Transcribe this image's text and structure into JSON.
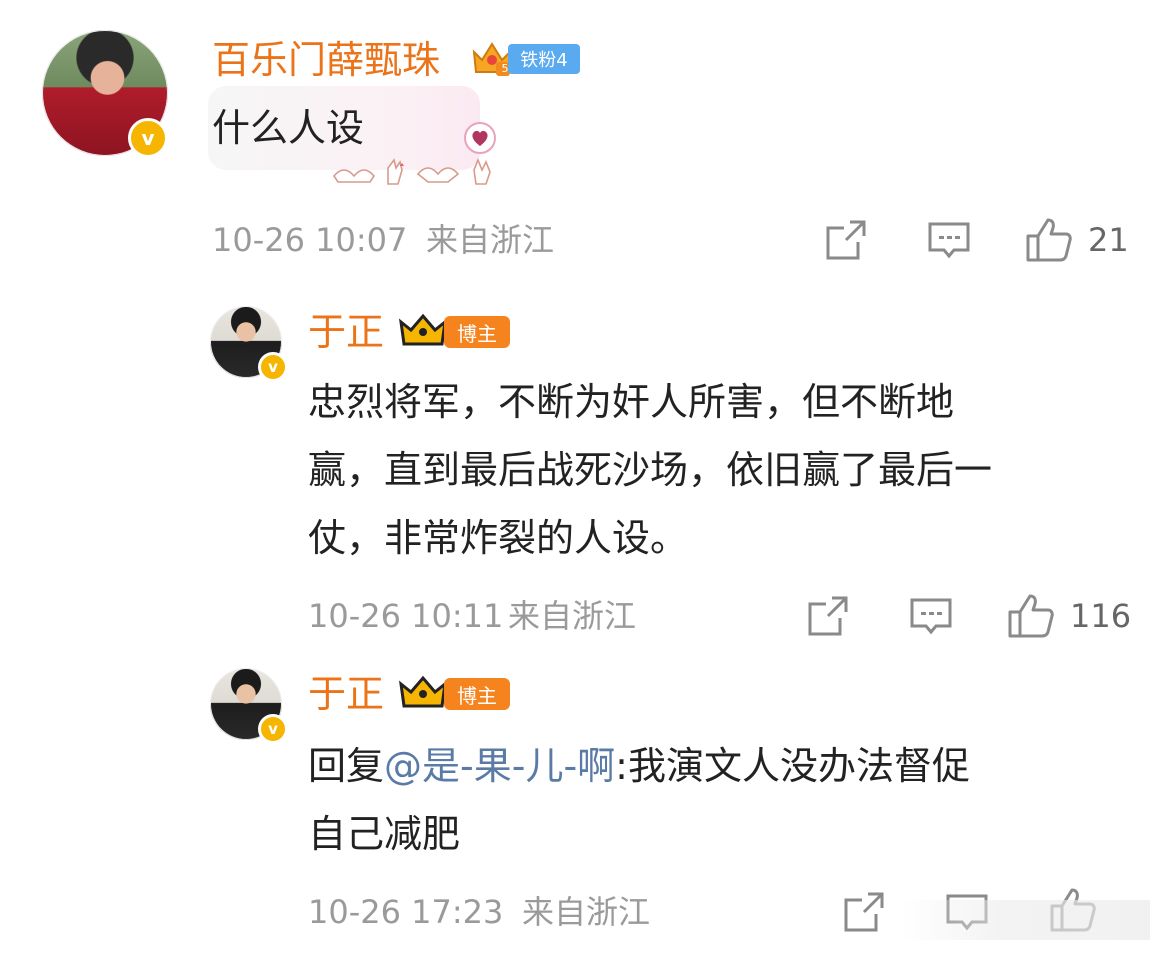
{
  "comments": [
    {
      "username": "百乐门薛甄珠",
      "fan_badge": "铁粉4",
      "fan_level": "5",
      "text": "什么人设",
      "time": "10-26 10:07",
      "location": "来自浙江",
      "likes": "21"
    },
    {
      "username": "于正",
      "role_badge": "博主",
      "text_lines": [
        "忠烈将军，不断为奸人所害，但不断地",
        "赢，直到最后战死沙场，依旧赢了最后一",
        "仗，非常炸裂的人设。"
      ],
      "time": "10-26 10:11",
      "location": "来自浙江",
      "likes": "116"
    },
    {
      "username": "于正",
      "role_badge": "博主",
      "reply_prefix": "回复",
      "mention": "@是-果-儿-啊",
      "reply_line1": ":我演文人没办法督促",
      "reply_line2": "自己减肥",
      "time": "10-26 17:23",
      "location": "来自浙江"
    }
  ],
  "icons": {
    "repost": "share-icon",
    "comment": "comment-icon",
    "like": "thumbs-up-icon",
    "verified": "verified-v-icon",
    "crown": "crown-icon",
    "heart": "heart-icon"
  },
  "colors": {
    "username": "#eb7318",
    "mention": "#5a7ba6",
    "meta": "#9a9a9a",
    "verified": "#f6b500",
    "fan_badge": "#5aaaf0",
    "role_badge": "#f5841f"
  }
}
